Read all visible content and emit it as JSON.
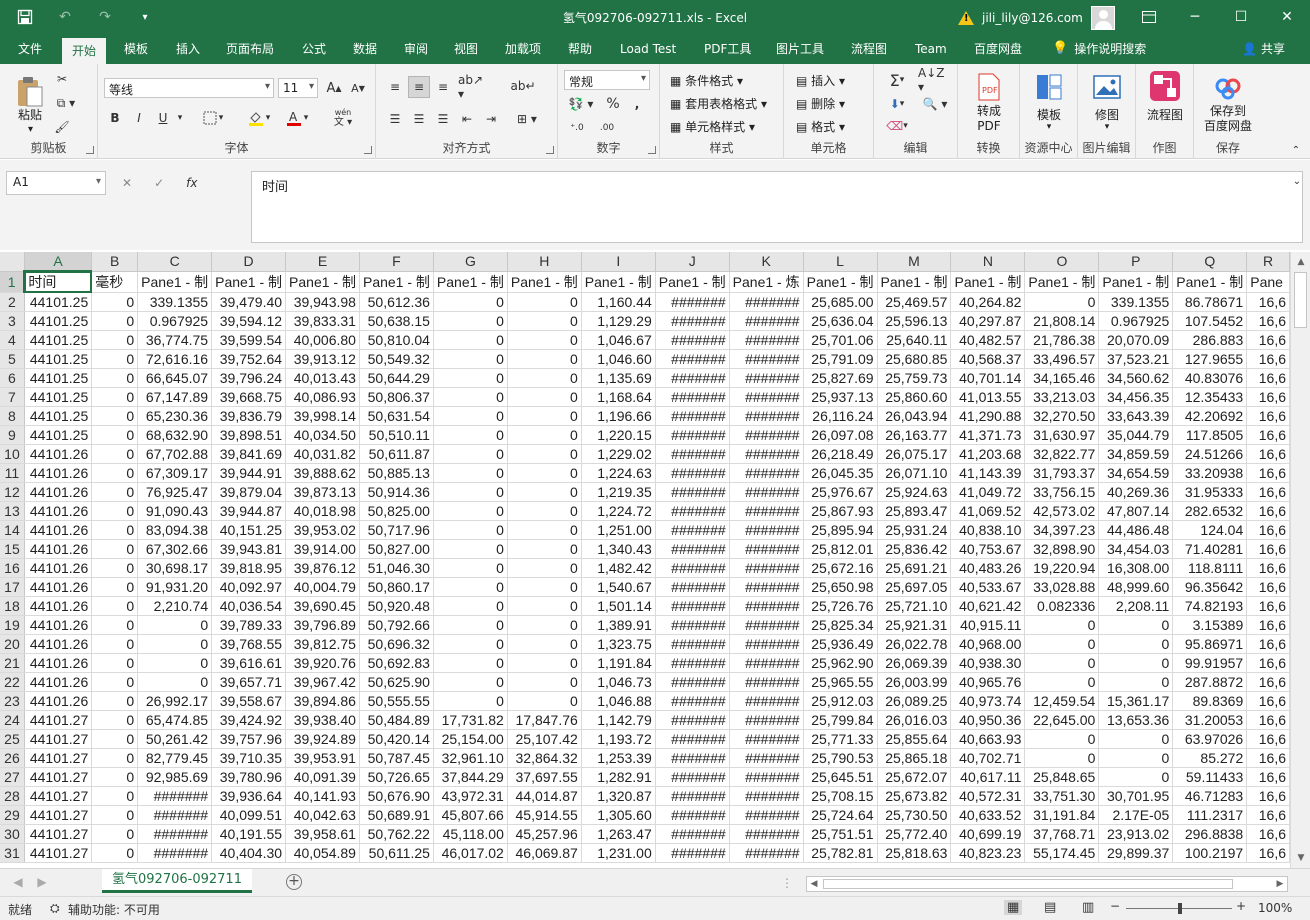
{
  "title": "氢气092706-092711.xls  -  Excel",
  "account": {
    "name": "jili_lily@126.com"
  },
  "window_buttons": [
    "─",
    "☐",
    "✕"
  ],
  "qat": {
    "save": "💾",
    "undo": "↶",
    "redo": "↷",
    "customize": "⯆"
  },
  "tabs": [
    "文件",
    "开始",
    "模板",
    "插入",
    "页面布局",
    "公式",
    "数据",
    "审阅",
    "视图",
    "加载项",
    "帮助",
    "Load Test",
    "PDF工具",
    "图片工具",
    "流程图",
    "Team",
    "百度网盘"
  ],
  "active_tab": "开始",
  "tell_me": "操作说明搜索",
  "share": "共享",
  "ribbon": {
    "clipboard": {
      "label": "剪贴板",
      "paste": "粘贴"
    },
    "font": {
      "label": "字体",
      "font_name": "等线",
      "font_size": "11",
      "bold": "B",
      "italic": "I",
      "underline": "U"
    },
    "alignment": {
      "label": "对齐方式"
    },
    "number": {
      "label": "数字",
      "format": "常规",
      "percent": "%"
    },
    "styles": {
      "label": "样式",
      "conditional": "条件格式",
      "table": "套用表格格式",
      "cell_styles": "单元格样式"
    },
    "cells": {
      "label": "单元格",
      "insert": "插入",
      "delete": "删除",
      "format": "格式"
    },
    "editing": {
      "label": "编辑"
    },
    "convert": {
      "label": "转换",
      "button": "转成\nPDF"
    },
    "resources": {
      "label": "资源中心",
      "button": "模板"
    },
    "picedit": {
      "label": "图片编辑",
      "button": "修图"
    },
    "draw": {
      "label": "作图",
      "button": "流程图"
    },
    "save": {
      "label": "保存",
      "button": "保存到\n百度网盘"
    }
  },
  "name_box": "A1",
  "formula_buttons": {
    "cancel": "✕",
    "enter": "✓",
    "fx": "fx"
  },
  "formula": "时间",
  "columns": [
    "A",
    "B",
    "C",
    "D",
    "E",
    "F",
    "G",
    "H",
    "I",
    "J",
    "K",
    "L",
    "M",
    "N",
    "O",
    "P",
    "Q",
    "R"
  ],
  "header_row": [
    "时间",
    "毫秒",
    "Pane1 - 制",
    "Pane1 - 制",
    "Pane1 - 制",
    "Pane1 - 制",
    "Pane1 - 制",
    "Pane1 - 制",
    "Pane1 - 制",
    "Pane1 - 制",
    "Pane1 - 炼",
    "Pane1 - 制",
    "Pane1 - 制",
    "Pane1 - 制",
    "Pane1 - 制",
    "Pane1 - 制",
    "Pane1 - 制",
    "Pane"
  ],
  "rows": [
    [
      "44101.25",
      "0",
      "339.1355",
      "39,479.40",
      "39,943.98",
      "50,612.36",
      "0",
      "0",
      "1,160.44",
      "#######",
      "#######",
      "25,685.00",
      "25,469.57",
      "40,264.82",
      "0",
      "339.1355",
      "86.78671",
      "16,6"
    ],
    [
      "44101.25",
      "0",
      "0.967925",
      "39,594.12",
      "39,833.31",
      "50,638.15",
      "0",
      "0",
      "1,129.29",
      "#######",
      "#######",
      "25,636.04",
      "25,596.13",
      "40,297.87",
      "21,808.14",
      "0.967925",
      "107.5452",
      "16,6"
    ],
    [
      "44101.25",
      "0",
      "36,774.75",
      "39,599.54",
      "40,006.80",
      "50,810.04",
      "0",
      "0",
      "1,046.67",
      "#######",
      "#######",
      "25,701.06",
      "25,640.11",
      "40,482.57",
      "21,786.38",
      "20,070.09",
      "286.883",
      "16,6"
    ],
    [
      "44101.25",
      "0",
      "72,616.16",
      "39,752.64",
      "39,913.12",
      "50,549.32",
      "0",
      "0",
      "1,046.60",
      "#######",
      "#######",
      "25,791.09",
      "25,680.85",
      "40,568.37",
      "33,496.57",
      "37,523.21",
      "127.9655",
      "16,6"
    ],
    [
      "44101.25",
      "0",
      "66,645.07",
      "39,796.24",
      "40,013.43",
      "50,644.29",
      "0",
      "0",
      "1,135.69",
      "#######",
      "#######",
      "25,827.69",
      "25,759.73",
      "40,701.14",
      "34,165.46",
      "34,560.62",
      "40.83076",
      "16,6"
    ],
    [
      "44101.25",
      "0",
      "67,147.89",
      "39,668.75",
      "40,086.93",
      "50,806.37",
      "0",
      "0",
      "1,168.64",
      "#######",
      "#######",
      "25,937.13",
      "25,860.60",
      "41,013.55",
      "33,213.03",
      "34,456.35",
      "12.35433",
      "16,6"
    ],
    [
      "44101.25",
      "0",
      "65,230.36",
      "39,836.79",
      "39,998.14",
      "50,631.54",
      "0",
      "0",
      "1,196.66",
      "#######",
      "#######",
      "26,116.24",
      "26,043.94",
      "41,290.88",
      "32,270.50",
      "33,643.39",
      "42.20692",
      "16,6"
    ],
    [
      "44101.25",
      "0",
      "68,632.90",
      "39,898.51",
      "40,034.50",
      "50,510.11",
      "0",
      "0",
      "1,220.15",
      "#######",
      "#######",
      "26,097.08",
      "26,163.77",
      "41,371.73",
      "31,630.97",
      "35,044.79",
      "117.8505",
      "16,6"
    ],
    [
      "44101.26",
      "0",
      "67,702.88",
      "39,841.69",
      "40,031.82",
      "50,611.87",
      "0",
      "0",
      "1,229.02",
      "#######",
      "#######",
      "26,218.49",
      "26,075.17",
      "41,203.68",
      "32,822.77",
      "34,859.59",
      "24.51266",
      "16,6"
    ],
    [
      "44101.26",
      "0",
      "67,309.17",
      "39,944.91",
      "39,888.62",
      "50,885.13",
      "0",
      "0",
      "1,224.63",
      "#######",
      "#######",
      "26,045.35",
      "26,071.10",
      "41,143.39",
      "31,793.37",
      "34,654.59",
      "33.20938",
      "16,6"
    ],
    [
      "44101.26",
      "0",
      "76,925.47",
      "39,879.04",
      "39,873.13",
      "50,914.36",
      "0",
      "0",
      "1,219.35",
      "#######",
      "#######",
      "25,976.67",
      "25,924.63",
      "41,049.72",
      "33,756.15",
      "40,269.36",
      "31.95333",
      "16,6"
    ],
    [
      "44101.26",
      "0",
      "91,090.43",
      "39,944.87",
      "40,018.98",
      "50,825.00",
      "0",
      "0",
      "1,224.72",
      "#######",
      "#######",
      "25,867.93",
      "25,893.47",
      "41,069.52",
      "42,573.02",
      "47,807.14",
      "282.6532",
      "16,6"
    ],
    [
      "44101.26",
      "0",
      "83,094.38",
      "40,151.25",
      "39,953.02",
      "50,717.96",
      "0",
      "0",
      "1,251.00",
      "#######",
      "#######",
      "25,895.94",
      "25,931.24",
      "40,838.10",
      "34,397.23",
      "44,486.48",
      "124.04",
      "16,6"
    ],
    [
      "44101.26",
      "0",
      "67,302.66",
      "39,943.81",
      "39,914.00",
      "50,827.00",
      "0",
      "0",
      "1,340.43",
      "#######",
      "#######",
      "25,812.01",
      "25,836.42",
      "40,753.67",
      "32,898.90",
      "34,454.03",
      "71.40281",
      "16,6"
    ],
    [
      "44101.26",
      "0",
      "30,698.17",
      "39,818.95",
      "39,876.12",
      "51,046.30",
      "0",
      "0",
      "1,482.42",
      "#######",
      "#######",
      "25,672.16",
      "25,691.21",
      "40,483.26",
      "19,220.94",
      "16,308.00",
      "118.8111",
      "16,6"
    ],
    [
      "44101.26",
      "0",
      "91,931.20",
      "40,092.97",
      "40,004.79",
      "50,860.17",
      "0",
      "0",
      "1,540.67",
      "#######",
      "#######",
      "25,650.98",
      "25,697.05",
      "40,533.67",
      "33,028.88",
      "48,999.60",
      "96.35642",
      "16,6"
    ],
    [
      "44101.26",
      "0",
      "2,210.74",
      "40,036.54",
      "39,690.45",
      "50,920.48",
      "0",
      "0",
      "1,501.14",
      "#######",
      "#######",
      "25,726.76",
      "25,721.10",
      "40,621.42",
      "0.082336",
      "2,208.11",
      "74.82193",
      "16,6"
    ],
    [
      "44101.26",
      "0",
      "0",
      "39,789.33",
      "39,796.89",
      "50,792.66",
      "0",
      "0",
      "1,389.91",
      "#######",
      "#######",
      "25,825.34",
      "25,921.31",
      "40,915.11",
      "0",
      "0",
      "3.15389",
      "16,6"
    ],
    [
      "44101.26",
      "0",
      "0",
      "39,768.55",
      "39,812.75",
      "50,696.32",
      "0",
      "0",
      "1,323.75",
      "#######",
      "#######",
      "25,936.49",
      "26,022.78",
      "40,968.00",
      "0",
      "0",
      "95.86971",
      "16,6"
    ],
    [
      "44101.26",
      "0",
      "0",
      "39,616.61",
      "39,920.76",
      "50,692.83",
      "0",
      "0",
      "1,191.84",
      "#######",
      "#######",
      "25,962.90",
      "26,069.39",
      "40,938.30",
      "0",
      "0",
      "99.91957",
      "16,6"
    ],
    [
      "44101.26",
      "0",
      "0",
      "39,657.71",
      "39,967.42",
      "50,625.90",
      "0",
      "0",
      "1,046.73",
      "#######",
      "#######",
      "25,965.55",
      "26,003.99",
      "40,965.76",
      "0",
      "0",
      "287.8872",
      "16,6"
    ],
    [
      "44101.26",
      "0",
      "26,992.17",
      "39,558.67",
      "39,894.86",
      "50,555.55",
      "0",
      "0",
      "1,046.88",
      "#######",
      "#######",
      "25,912.03",
      "26,089.25",
      "40,973.74",
      "12,459.54",
      "15,361.17",
      "89.8369",
      "16,6"
    ],
    [
      "44101.27",
      "0",
      "65,474.85",
      "39,424.92",
      "39,938.40",
      "50,484.89",
      "17,731.82",
      "17,847.76",
      "1,142.79",
      "#######",
      "#######",
      "25,799.84",
      "26,016.03",
      "40,950.36",
      "22,645.00",
      "13,653.36",
      "31.20053",
      "16,6"
    ],
    [
      "44101.27",
      "0",
      "50,261.42",
      "39,757.96",
      "39,924.89",
      "50,420.14",
      "25,154.00",
      "25,107.42",
      "1,193.72",
      "#######",
      "#######",
      "25,771.33",
      "25,855.64",
      "40,663.93",
      "0",
      "0",
      "63.97026",
      "16,6"
    ],
    [
      "44101.27",
      "0",
      "82,779.45",
      "39,710.35",
      "39,953.91",
      "50,787.45",
      "32,961.10",
      "32,864.32",
      "1,253.39",
      "#######",
      "#######",
      "25,790.53",
      "25,865.18",
      "40,702.71",
      "0",
      "0",
      "85.272",
      "16,6"
    ],
    [
      "44101.27",
      "0",
      "92,985.69",
      "39,780.96",
      "40,091.39",
      "50,726.65",
      "37,844.29",
      "37,697.55",
      "1,282.91",
      "#######",
      "#######",
      "25,645.51",
      "25,672.07",
      "40,617.11",
      "25,848.65",
      "0",
      "59.11433",
      "16,6"
    ],
    [
      "44101.27",
      "0",
      "#######",
      "39,936.64",
      "40,141.93",
      "50,676.90",
      "43,972.31",
      "44,014.87",
      "1,320.87",
      "#######",
      "#######",
      "25,708.15",
      "25,673.82",
      "40,572.31",
      "33,751.30",
      "30,701.95",
      "46.71283",
      "16,6"
    ],
    [
      "44101.27",
      "0",
      "#######",
      "40,099.51",
      "40,042.63",
      "50,689.91",
      "45,807.66",
      "45,914.55",
      "1,305.60",
      "#######",
      "#######",
      "25,724.64",
      "25,730.50",
      "40,633.52",
      "31,191.84",
      "2.17E-05",
      "111.2317",
      "16,6"
    ],
    [
      "44101.27",
      "0",
      "#######",
      "40,191.55",
      "39,958.61",
      "50,762.22",
      "45,118.00",
      "45,257.96",
      "1,263.47",
      "#######",
      "#######",
      "25,751.51",
      "25,772.40",
      "40,699.19",
      "37,768.71",
      "23,913.02",
      "296.8838",
      "16,6"
    ],
    [
      "44101.27",
      "0",
      "#######",
      "40,404.30",
      "40,054.89",
      "50,611.25",
      "46,017.02",
      "46,069.87",
      "1,231.00",
      "#######",
      "#######",
      "25,782.81",
      "25,818.63",
      "40,823.23",
      "55,174.45",
      "29,899.37",
      "100.2197",
      "16,6"
    ]
  ],
  "sheet_tab": "氢气092706-092711",
  "status": {
    "ready": "就绪",
    "accessibility": "辅助功能: 不可用",
    "zoom": "100%"
  }
}
